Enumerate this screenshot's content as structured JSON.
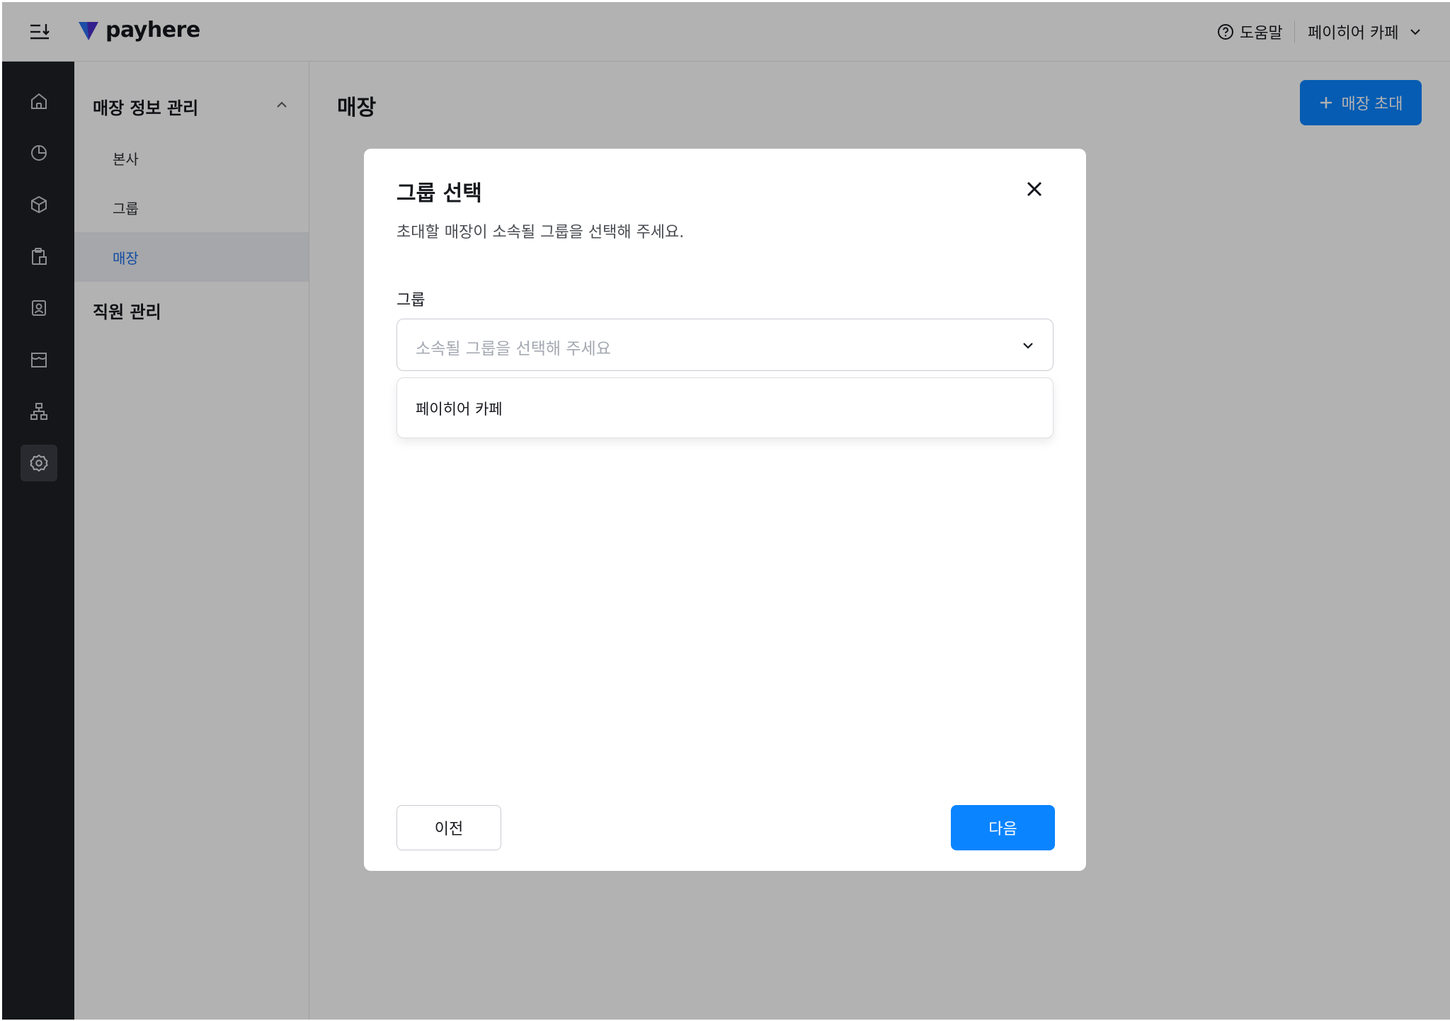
{
  "header": {
    "brand": "payhere",
    "help_label": "도움말",
    "store_name": "페이히어 카페"
  },
  "rail": {
    "icons": [
      "home-icon",
      "chart-icon",
      "box-icon",
      "clipboard-icon",
      "contact-icon",
      "store-icon",
      "org-icon",
      "settings-icon"
    ],
    "active": "settings-icon"
  },
  "subnav": {
    "section1_title": "매장 정보 관리",
    "items": [
      {
        "label": "본사"
      },
      {
        "label": "그룹"
      },
      {
        "label": "매장"
      }
    ],
    "active_item": "매장",
    "section2_title": "직원 관리"
  },
  "main": {
    "title": "매장",
    "invite_label": "매장 초대"
  },
  "modal": {
    "title": "그룹 선택",
    "description": "초대할 매장이 소속될 그룹을 선택해 주세요.",
    "field_label": "그룹",
    "select_placeholder": "소속될 그룹을 선택해 주세요",
    "options": [
      "페이히어 카페"
    ],
    "prev_label": "이전",
    "next_label": "다음"
  },
  "colors": {
    "accent": "#0a84ff",
    "rail_bg": "#1e2026",
    "active_nav_text": "#1a6ee8"
  }
}
